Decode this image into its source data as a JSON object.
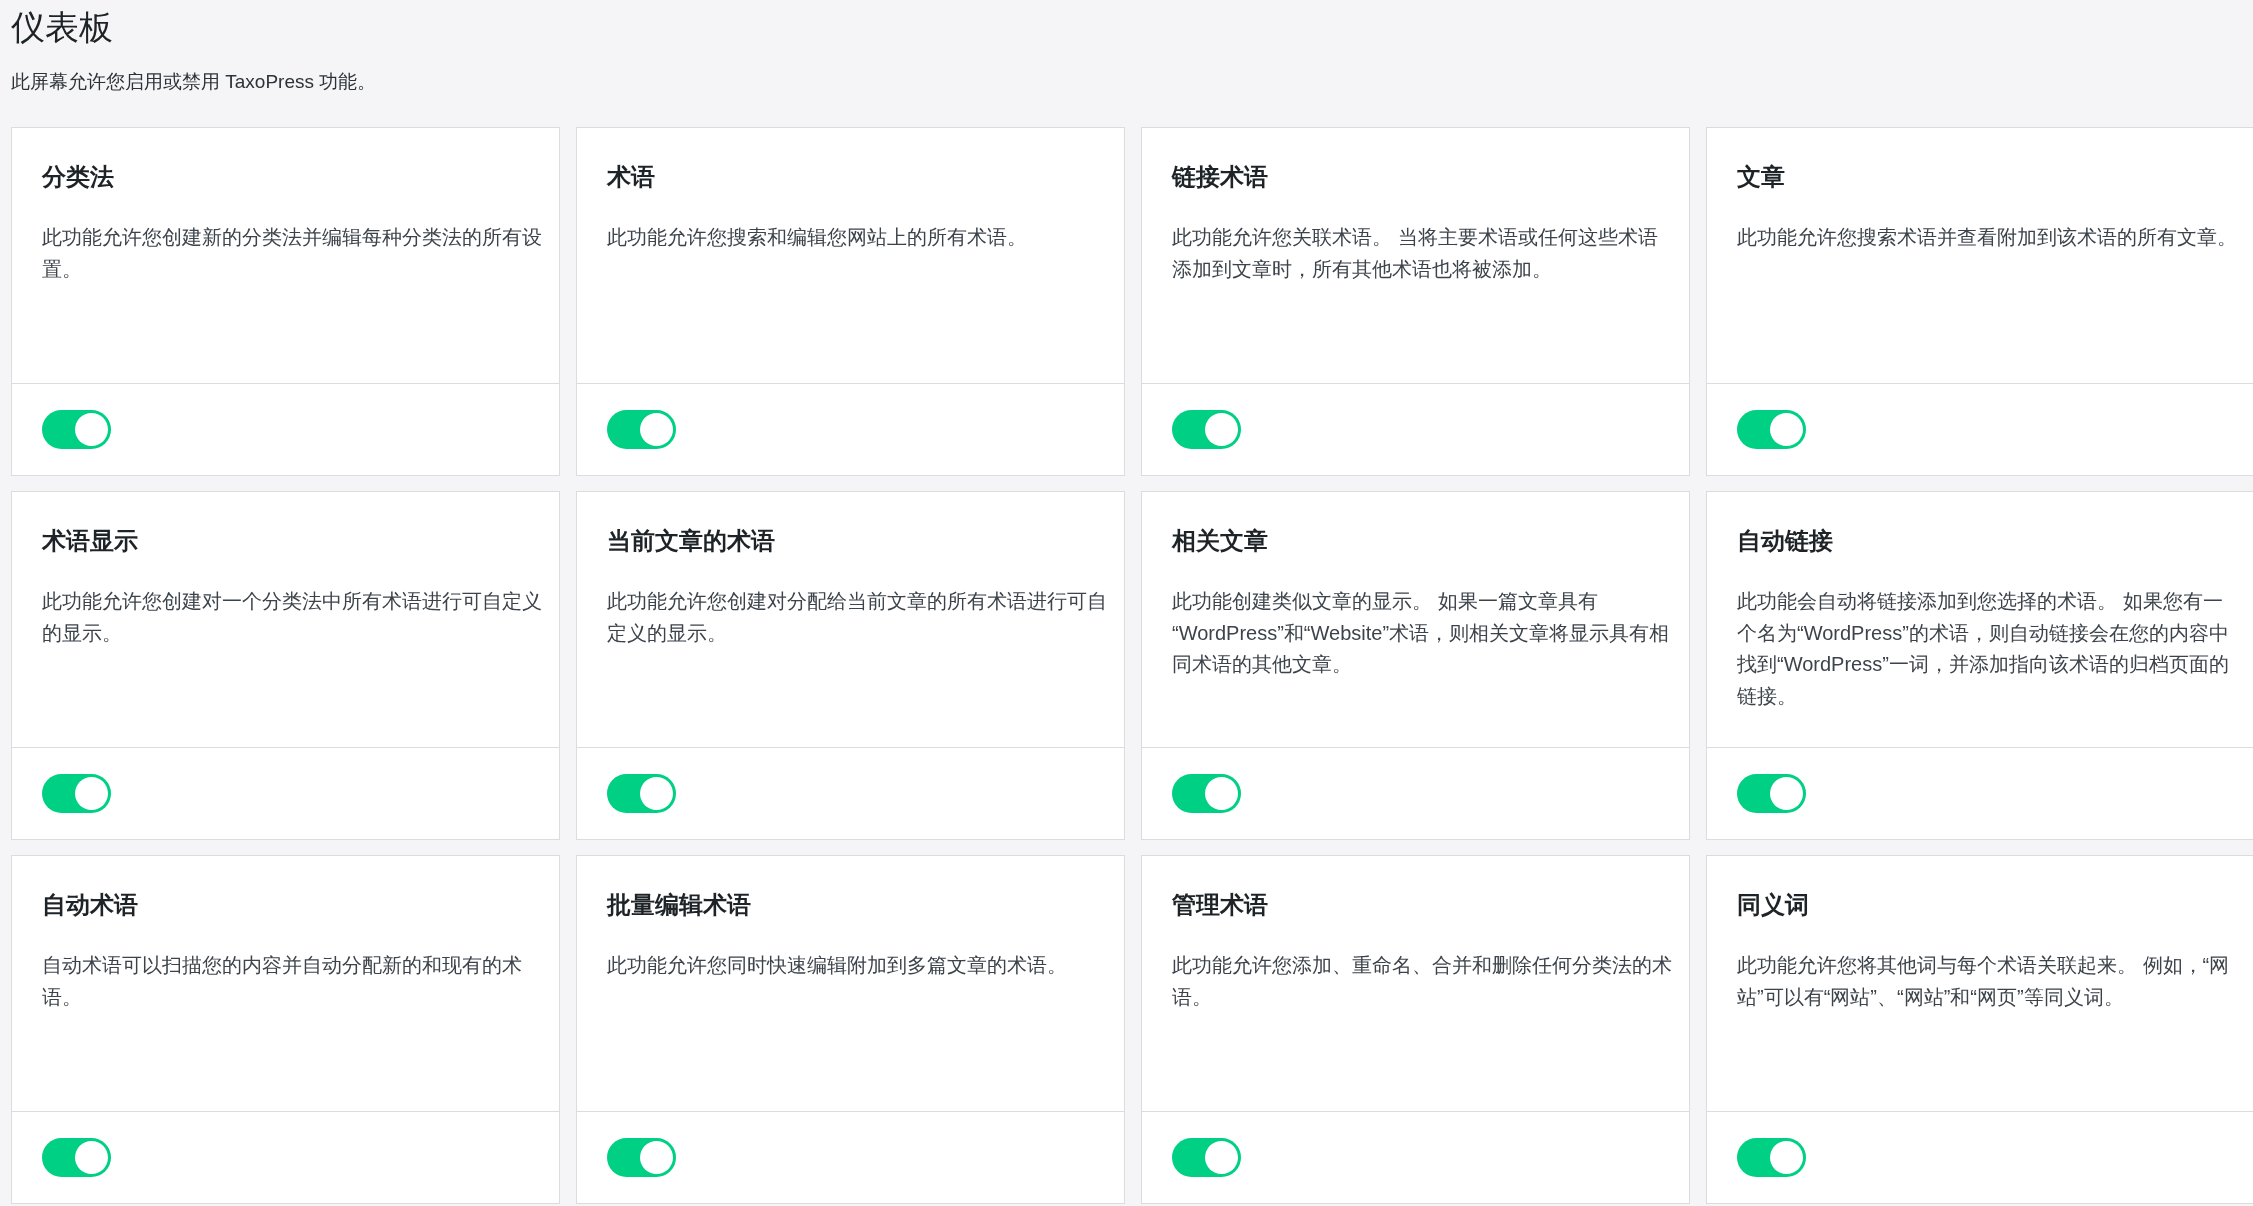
{
  "page": {
    "title": "仪表板",
    "description": "此屏幕允许您启用或禁用 TaxoPress 功能。"
  },
  "features": [
    {
      "title": "分类法",
      "description": "此功能允许您创建新的分类法并编辑每种分类法的所有设置。",
      "on": true
    },
    {
      "title": "术语",
      "description": "此功能允许您搜索和编辑您网站上的所有术语。",
      "on": true
    },
    {
      "title": "链接术语",
      "description": "此功能允许您关联术语。 当将主要术语或任何这些术语添加到文章时，所有其他术语也将被添加。",
      "on": true
    },
    {
      "title": "文章",
      "description": "此功能允许您搜索术语并查看附加到该术语的所有文章。",
      "on": true
    },
    {
      "title": "术语显示",
      "description": "此功能允许您创建对一个分类法中所有术语进行可自定义的显示。",
      "on": true
    },
    {
      "title": "当前文章的术语",
      "description": "此功能允许您创建对分配给当前文章的所有术语进行可自定义的显示。",
      "on": true
    },
    {
      "title": "相关文章",
      "description": "此功能创建类似文章的显示。 如果一篇文章具有“WordPress”和“Website”术语，则相关文章将显示具有相同术语的其他文章。",
      "on": true
    },
    {
      "title": "自动链接",
      "description": "此功能会自动将链接添加到您选择的术语。 如果您有一个名为“WordPress”的术语，则自动链接会在您的内容中找到“WordPress”一词，并添加指向该术语的归档页面的链接。",
      "on": true
    },
    {
      "title": "自动术语",
      "description": "自动术语可以扫描您的内容并自动分配新的和现有的术语。",
      "on": true
    },
    {
      "title": "批量编辑术语",
      "description": "此功能允许您同时快速编辑附加到多篇文章的术语。",
      "on": true
    },
    {
      "title": "管理术语",
      "description": "此功能允许您添加、重命名、合并和删除任何分类法的术语。",
      "on": true
    },
    {
      "title": "同义词",
      "description": "此功能允许您将其他词与每个术语关联起来。 例如，“网站”可以有“网站”、“网站”和“网页”等同义词。",
      "on": true
    }
  ]
}
